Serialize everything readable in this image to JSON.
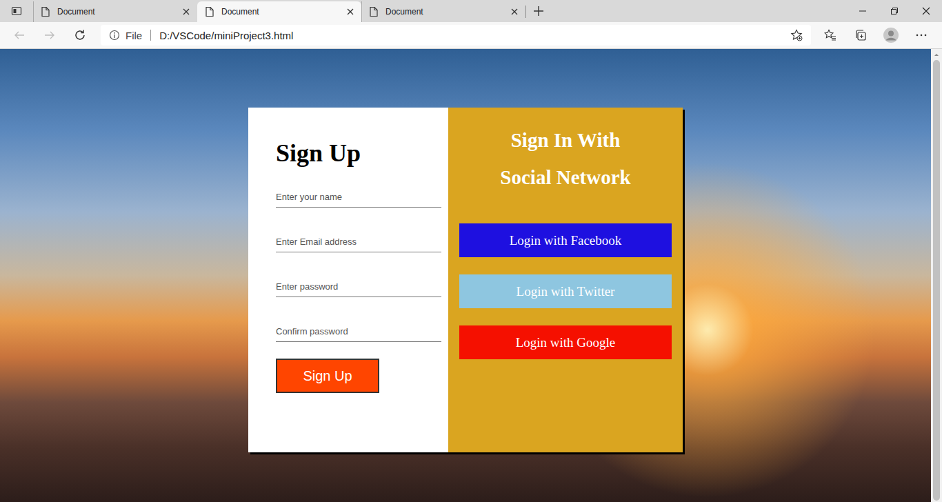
{
  "browser": {
    "tabs": [
      {
        "label": "Document",
        "selected": false
      },
      {
        "label": "Document",
        "selected": true
      },
      {
        "label": "Document",
        "selected": false
      }
    ],
    "address": {
      "scheme": "File",
      "url": "D:/VSCode/miniProject3.html"
    },
    "back_enabled": false,
    "forward_enabled": false
  },
  "page": {
    "signup": {
      "title": "Sign Up",
      "fields": [
        {
          "placeholder": "Enter your name",
          "kind": "text"
        },
        {
          "placeholder": "Enter Email address",
          "kind": "email"
        },
        {
          "placeholder": "Enter password",
          "kind": "password"
        },
        {
          "placeholder": "Confirm password",
          "kind": "password"
        }
      ],
      "button": "Sign Up"
    },
    "social": {
      "title_lines": [
        "Sign In With",
        "Social Network"
      ],
      "buttons": [
        {
          "label": "Login with Facebook",
          "color": "#1e10e0"
        },
        {
          "label": "Login with Twitter",
          "color": "#8ec6e0"
        },
        {
          "label": "Login with Google",
          "color": "#f51000"
        }
      ]
    }
  }
}
